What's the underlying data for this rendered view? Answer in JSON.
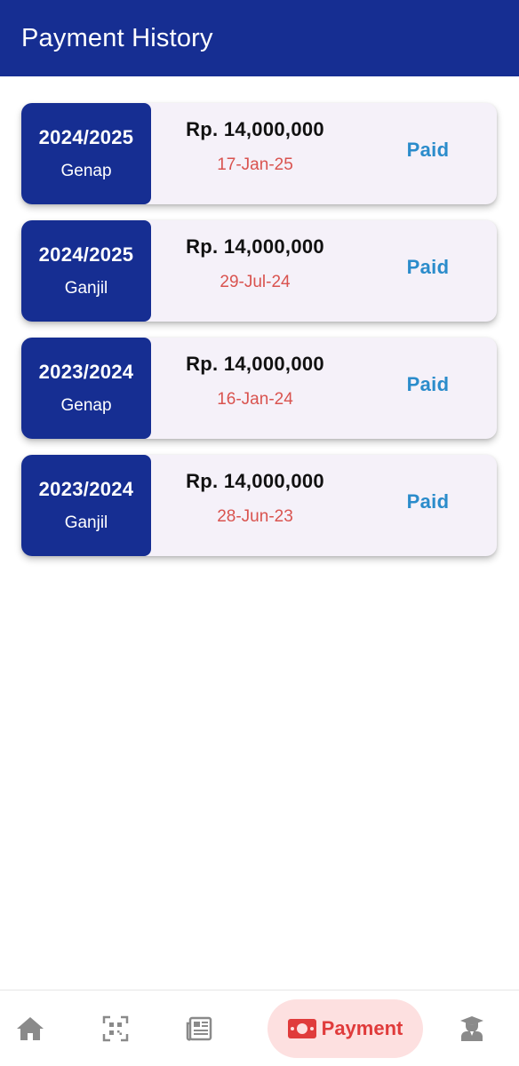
{
  "header": {
    "title": "Payment History"
  },
  "payments": [
    {
      "year": "2024/2025",
      "term": "Genap",
      "amount": "Rp. 14,000,000",
      "date": "17-Jan-25",
      "status": "Paid"
    },
    {
      "year": "2024/2025",
      "term": "Ganjil",
      "amount": "Rp. 14,000,000",
      "date": "29-Jul-24",
      "status": "Paid"
    },
    {
      "year": "2023/2024",
      "term": "Genap",
      "amount": "Rp. 14,000,000",
      "date": "16-Jan-24",
      "status": "Paid"
    },
    {
      "year": "2023/2024",
      "term": "Ganjil",
      "amount": "Rp. 14,000,000",
      "date": "28-Jun-23",
      "status": "Paid"
    }
  ],
  "bottom_nav": {
    "items": [
      {
        "icon": "home-icon"
      },
      {
        "icon": "qr-scan-icon"
      },
      {
        "icon": "newspaper-icon"
      },
      {
        "icon": "money-bill-icon",
        "label": "Payment",
        "active": true
      },
      {
        "icon": "graduate-icon"
      }
    ]
  },
  "colors": {
    "primary": "#162e92",
    "card_bg": "#f5f1f9",
    "date_text": "#d9534f",
    "status_text": "#2b8ccb",
    "nav_active_bg": "#fde0e0",
    "nav_active_text": "#e03b3b",
    "nav_inactive": "#8a8a8a"
  }
}
